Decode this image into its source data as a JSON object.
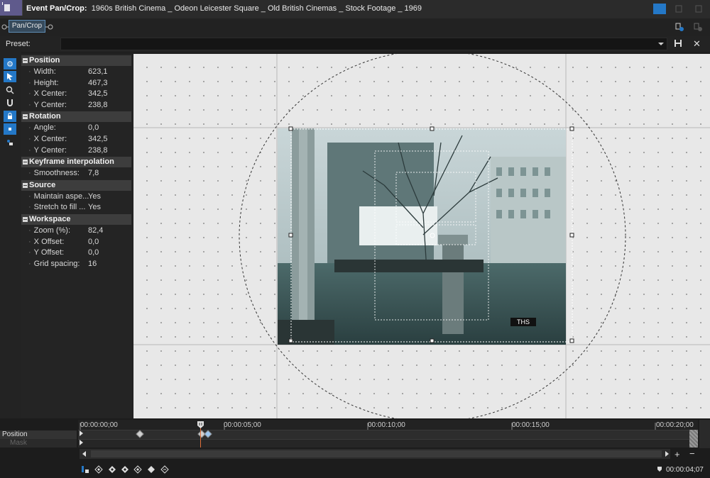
{
  "window": {
    "title_prefix": "Event Pan/Crop:",
    "title_rest": "1960s British Cinema _ Odeon Leicester Square _ Old British Cinemas _ Stock Footage _ 1969"
  },
  "effect_chain": {
    "chip_label": "Pan/Crop"
  },
  "preset": {
    "label": "Preset:",
    "value": ""
  },
  "tools": [
    "gear-icon",
    "select-arrow-icon",
    "zoom-icon",
    "magnet-icon",
    "lock-icon",
    "move-icon",
    "lock-small-icon"
  ],
  "sections": [
    {
      "title": "Position",
      "rows": [
        {
          "label": "Width:",
          "value": "623,1"
        },
        {
          "label": "Height:",
          "value": "467,3"
        },
        {
          "label": "X Center:",
          "value": "342,5"
        },
        {
          "label": "Y Center:",
          "value": "238,8"
        }
      ]
    },
    {
      "title": "Rotation",
      "rows": [
        {
          "label": "Angle:",
          "value": "0,0"
        },
        {
          "label": "X Center:",
          "value": "342,5"
        },
        {
          "label": "Y Center:",
          "value": "238,8"
        }
      ]
    },
    {
      "title": "Keyframe interpolation",
      "rows": [
        {
          "label": "Smoothness:",
          "value": "7,8"
        }
      ]
    },
    {
      "title": "Source",
      "rows": [
        {
          "label": "Maintain aspe...",
          "value": "Yes"
        },
        {
          "label": "Stretch to fill ...",
          "value": "Yes"
        }
      ]
    },
    {
      "title": "Workspace",
      "rows": [
        {
          "label": "Zoom (%):",
          "value": "82,4"
        },
        {
          "label": "X Offset:",
          "value": "0,0"
        },
        {
          "label": "Y Offset:",
          "value": "0,0"
        },
        {
          "label": "Grid spacing:",
          "value": "16"
        }
      ]
    }
  ],
  "video": {
    "watermark": "THS"
  },
  "timeline": {
    "ticks": [
      "00:00:00;00",
      "00:00:05;00",
      "00:00:10;00",
      "00:00:15;00",
      "00:00:20;00"
    ],
    "track_position": "Position",
    "track_mask": "Mask",
    "current_time": "00:00:04;07"
  },
  "colors": {
    "accent": "#2478c7",
    "cursor": "#e0703a",
    "canvas_bg": "#e8e8e8"
  }
}
